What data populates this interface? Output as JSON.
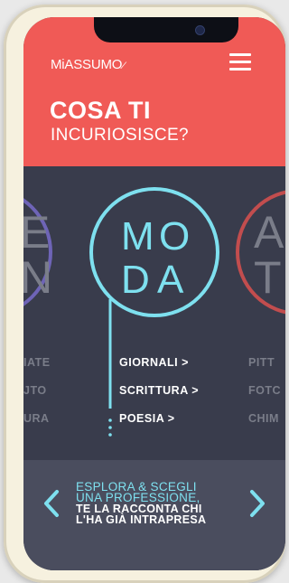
{
  "header": {
    "logo_text": "MiASSUMO",
    "title": "COSA TI",
    "subtitle": "INCURIOSISCE?"
  },
  "carousel": {
    "left_partial": {
      "letters": [
        "E",
        "N"
      ],
      "items": [
        "IATE",
        "JTO",
        "URA"
      ]
    },
    "center": {
      "letters": [
        "M",
        "O",
        "D",
        "A"
      ],
      "items": [
        "GIORNALI >",
        "SCRITTURA >",
        "POESIA >"
      ]
    },
    "right_partial": {
      "letters": [
        "A",
        "T"
      ],
      "items": [
        "PITT",
        "FOTC",
        "CHIM"
      ]
    }
  },
  "footer": {
    "line1": "ESPLORA & SCEGLI",
    "line2": "UNA PROFESSIONE,",
    "line3": "TE LA RACCONTA CHI",
    "line4": "L'HA GIÀ INTRAPRESA"
  },
  "colors": {
    "header_bg": "#f05a56",
    "body_bg": "#393c4c",
    "footer_bg": "#4a4d5e",
    "accent_cyan": "#7ee0ef",
    "left_circle": "#6e64b7",
    "right_circle": "#c24d4e"
  },
  "icons": {
    "menu": "hamburger-icon",
    "prev": "chevron-left-icon",
    "next": "chevron-right-icon"
  }
}
